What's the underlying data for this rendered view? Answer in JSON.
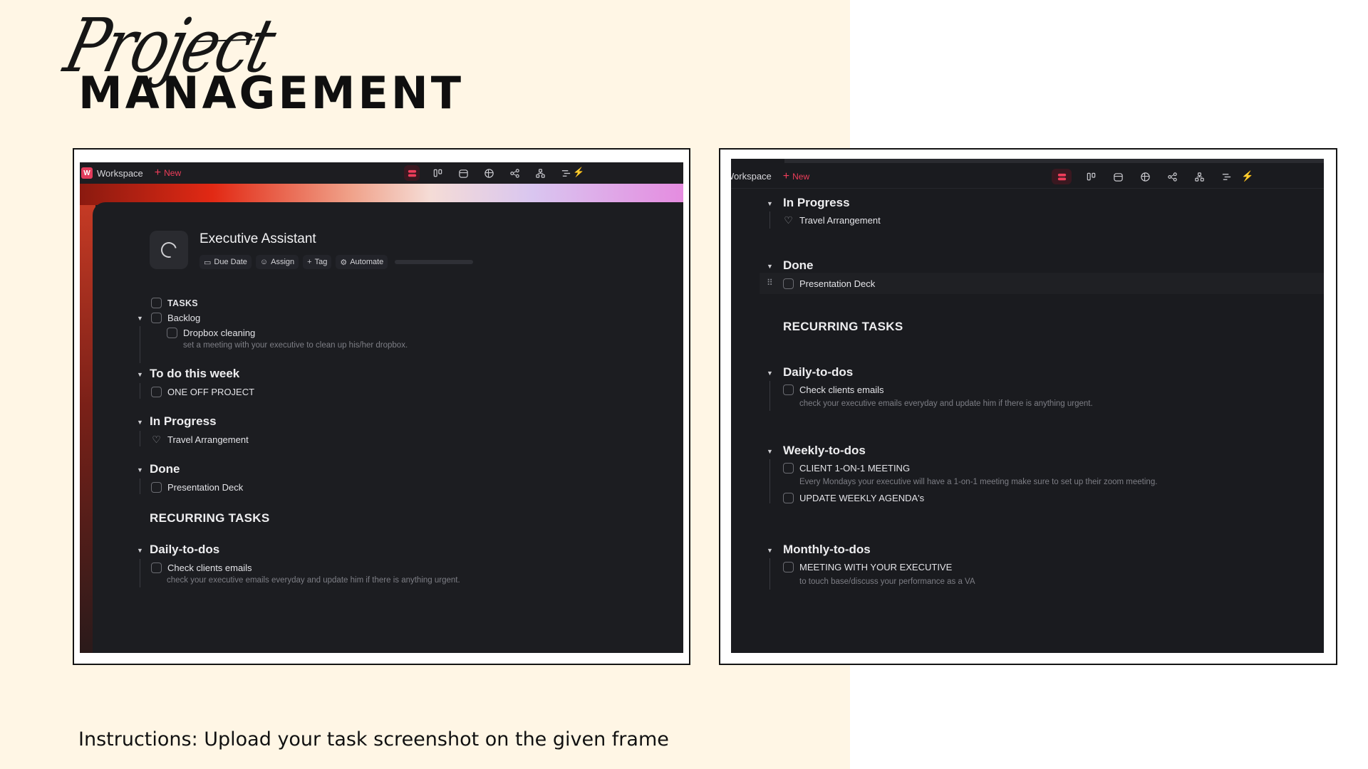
{
  "heading": {
    "script": "Project",
    "main": "MANAGEMENT"
  },
  "instructions": "Instructions: Upload your task screenshot on the given frame",
  "colors": {
    "cream_background": "#fff6e5",
    "app_dark": "#1b1c20",
    "accent": "#ef3d5a"
  },
  "left_screenshot": {
    "workspace_logo": "W",
    "workspace": "Workspace",
    "new_button": "New",
    "view_icons": [
      "list-view-icon",
      "board-view-icon",
      "calendar-view-icon",
      "table-view-icon",
      "mindmap-view-icon",
      "hierarchy-view-icon",
      "gantt-view-icon",
      "automation-bolt-icon"
    ],
    "page_title": "Executive Assistant",
    "meta": {
      "due_date": "Due Date",
      "assign": "Assign",
      "tag": "Tag",
      "automate": "Automate"
    },
    "tasks_label": "TASKS",
    "backlog": {
      "label": "Backlog",
      "items": [
        {
          "title": "Dropbox cleaning",
          "desc": "set a meeting with your executive to clean up his/her dropbox."
        }
      ]
    },
    "groups": [
      {
        "title": "To do this week",
        "items": [
          "ONE OFF PROJECT"
        ]
      },
      {
        "title": "In Progress",
        "items": [
          "Travel Arrangement"
        ]
      },
      {
        "title": "Done",
        "items": [
          "Presentation Deck"
        ]
      }
    ],
    "recurring_title": "RECURRING TASKS",
    "daily": {
      "title": "Daily-to-dos",
      "item": "Check clients emails",
      "desc": "check your executive emails everyday and update him if there is anything urgent."
    }
  },
  "right_screenshot": {
    "workspace": "Workspace",
    "new_button": "New",
    "view_icons": [
      "list-view-icon",
      "board-view-icon",
      "calendar-view-icon",
      "table-view-icon",
      "mindmap-view-icon",
      "hierarchy-view-icon",
      "gantt-view-icon",
      "automation-bolt-icon"
    ],
    "in_progress": {
      "title": "In Progress",
      "item": "Travel Arrangement"
    },
    "done": {
      "title": "Done",
      "item": "Presentation Deck"
    },
    "recurring_title": "RECURRING TASKS",
    "daily": {
      "title": "Daily-to-dos",
      "item": "Check clients emails",
      "desc": "check your executive emails everyday and update him if there is anything urgent."
    },
    "weekly": {
      "title": "Weekly-to-dos",
      "items": [
        {
          "title": "CLIENT 1-ON-1 MEETING",
          "desc": "Every Mondays your executive will have a 1-on-1 meeting make sure to set up their zoom meeting."
        },
        {
          "title": "UPDATE WEEKLY AGENDA's",
          "desc": ""
        }
      ]
    },
    "monthly": {
      "title": "Monthly-to-dos",
      "item": "MEETING WITH YOUR EXECUTIVE",
      "desc": "to touch base/discuss your performance as a VA"
    }
  }
}
